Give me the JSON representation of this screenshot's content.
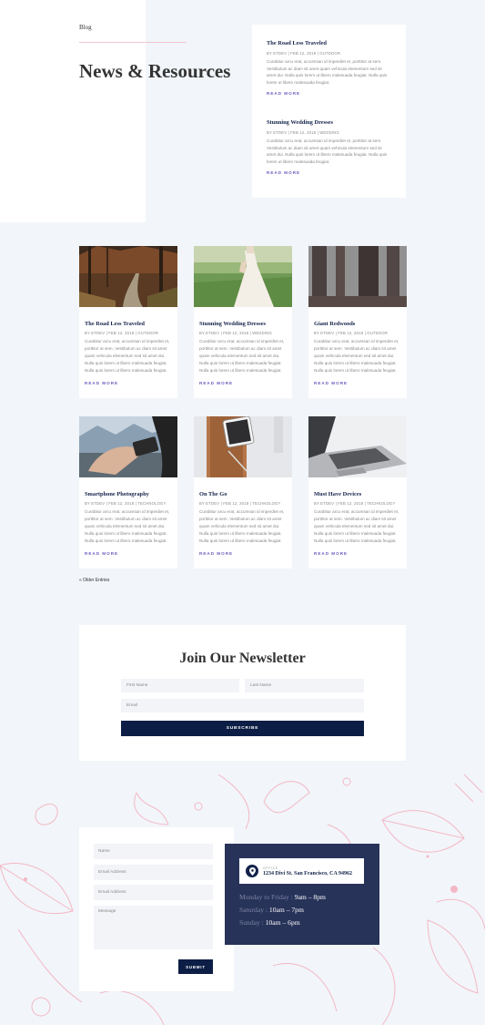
{
  "breadcrumb": "Blog",
  "page_title": "News & Resources",
  "featured": [
    {
      "title": "The Road Less Traveled",
      "meta": "BY ETDEV | FEB 12, 2018 | OUTDOOR",
      "excerpt": "Curabitur arcu erat, accumsan id imperdiet et, porttitor at sem. Vestibulum ac diam sit amet quam vehicula elementum sed sit amet dui. Nulla quis lorem ut libero malesuada feugiat. Nulla quis lorem ut libero malesuada feugiat.",
      "read_more": "READ MORE"
    },
    {
      "title": "Stunning Wedding Dresses",
      "meta": "BY ETDEV | FEB 12, 2018 | WEDDING",
      "excerpt": "Curabitur arcu erat, accumsan id imperdiet et, porttitor at sem. Vestibulum ac diam sit amet quam vehicula elementum sed sit amet dui. Nulla quis lorem ut libero malesuada feugiat. Nulla quis lorem ut libero malesuada feugiat.",
      "read_more": "READ MORE"
    }
  ],
  "cards": [
    {
      "title": "The Road Less Traveled",
      "meta": "BY ETDEV | FEB 12, 2018 | OUTDOOR",
      "excerpt": "Curabitur arcu erat, accumsan id imperdiet et, porttitor at sem. Vestibulum ac diam sit amet quam vehicula elementum sed sit amet dui. Nulla quis lorem ut libero malesuada feugiat. Nulla quis lorem ut libero malesuada feugiat.",
      "read_more": "READ MORE",
      "image": "forest-path-photo"
    },
    {
      "title": "Stunning Wedding Dresses",
      "meta": "BY ETDEV | FEB 12, 2018 | WEDDING",
      "excerpt": "Curabitur arcu erat, accumsan id imperdiet et, porttitor at sem. Vestibulum ac diam sit amet quam vehicula elementum sed sit amet dui. Nulla quis lorem ut libero malesuada feugiat. Nulla quis lorem ut libero malesuada feugiat.",
      "read_more": "READ MORE",
      "image": "wedding-dress-photo"
    },
    {
      "title": "Giant Redwoods",
      "meta": "BY ETDEV | FEB 12, 2018 | OUTDOOR",
      "excerpt": "Curabitur arcu erat, accumsan id imperdiet et, porttitor at sem. Vestibulum ac diam sit amet quam vehicula elementum sed sit amet dui. Nulla quis lorem ut libero malesuada feugiat. Nulla quis lorem ut libero malesuada feugiat.",
      "read_more": "READ MORE",
      "image": "redwoods-photo"
    },
    {
      "title": "Smartphone Photography",
      "meta": "BY ETDEV | FEB 12, 2018 | TECHNOLOGY",
      "excerpt": "Curabitur arcu erat, accumsan id imperdiet et, porttitor at sem. Vestibulum ac diam sit amet quam vehicula elementum sed sit amet dui. Nulla quis lorem ut libero malesuada feugiat. Nulla quis lorem ut libero malesuada feugiat.",
      "read_more": "READ MORE",
      "image": "phone-photo"
    },
    {
      "title": "On The Go",
      "meta": "BY ETDEV | FEB 12, 2018 | TECHNOLOGY",
      "excerpt": "Curabitur arcu erat, accumsan id imperdiet et, porttitor at sem. Vestibulum ac diam sit amet quam vehicula elementum sed sit amet dui. Nulla quis lorem ut libero malesuada feugiat. Nulla quis lorem ut libero malesuada feugiat.",
      "read_more": "READ MORE",
      "image": "tablet-photo"
    },
    {
      "title": "Must Have Devices",
      "meta": "BY ETDEV | FEB 12, 2018 | TECHNOLOGY",
      "excerpt": "Curabitur arcu erat, accumsan id imperdiet et, porttitor at sem. Vestibulum ac diam sit amet quam vehicula elementum sed sit amet dui. Nulla quis lorem ut libero malesuada feugiat. Nulla quis lorem ut libero malesuada feugiat.",
      "read_more": "READ MORE",
      "image": "laptop-photo"
    }
  ],
  "older_entries": "« Older Entries",
  "newsletter": {
    "title": "Join Our Newsletter",
    "first_name_placeholder": "First Name",
    "last_name_placeholder": "Last Name",
    "email_placeholder": "Email",
    "subscribe_label": "SUBSCRIBE"
  },
  "contact_form": {
    "name_placeholder": "Name",
    "email_placeholder": "Email Address",
    "email2_placeholder": "Email Address",
    "message_placeholder": "Message",
    "submit_label": "SUBMIT"
  },
  "office": {
    "label": "OFFICE",
    "address": "1234 Divi St. San Francisco, CA 94962",
    "hours": [
      {
        "day": "Monday to Friday :",
        "time": "9am – 8pm"
      },
      {
        "day": "Saturday :",
        "time": "10am – 7pm"
      },
      {
        "day": "Sunday :",
        "time": "10am – 6pm"
      }
    ]
  },
  "colors": {
    "navy": "#0c1e45",
    "office_bg": "#28335a",
    "accent": "#6c5bbd",
    "background": "#f2f5f9",
    "decor_pink": "#f3b8c6"
  }
}
